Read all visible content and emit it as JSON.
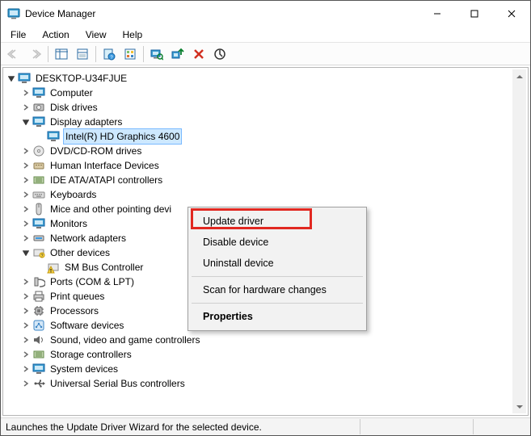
{
  "window": {
    "title": "Device Manager"
  },
  "menubar": {
    "file": "File",
    "action": "Action",
    "view": "View",
    "help": "Help"
  },
  "tree": {
    "root": "DESKTOP-U34FJUE",
    "computer": "Computer",
    "disk_drives": "Disk drives",
    "display_adapters": "Display adapters",
    "intel_gpu": "Intel(R) HD Graphics 4600",
    "dvd": "DVD/CD-ROM drives",
    "hid": "Human Interface Devices",
    "ide": "IDE ATA/ATAPI controllers",
    "keyboards": "Keyboards",
    "mice": "Mice and other pointing devi",
    "monitors": "Monitors",
    "network": "Network adapters",
    "other": "Other devices",
    "sm_bus": "SM Bus Controller",
    "ports": "Ports (COM & LPT)",
    "print_queues": "Print queues",
    "processors": "Processors",
    "software_devices": "Software devices",
    "sound": "Sound, video and game controllers",
    "storage": "Storage controllers",
    "system": "System devices",
    "usb": "Universal Serial Bus controllers"
  },
  "context_menu": {
    "update_driver": "Update driver",
    "disable_device": "Disable device",
    "uninstall_device": "Uninstall device",
    "scan": "Scan for hardware changes",
    "properties": "Properties"
  },
  "statusbar": {
    "text": "Launches the Update Driver Wizard for the selected device."
  }
}
